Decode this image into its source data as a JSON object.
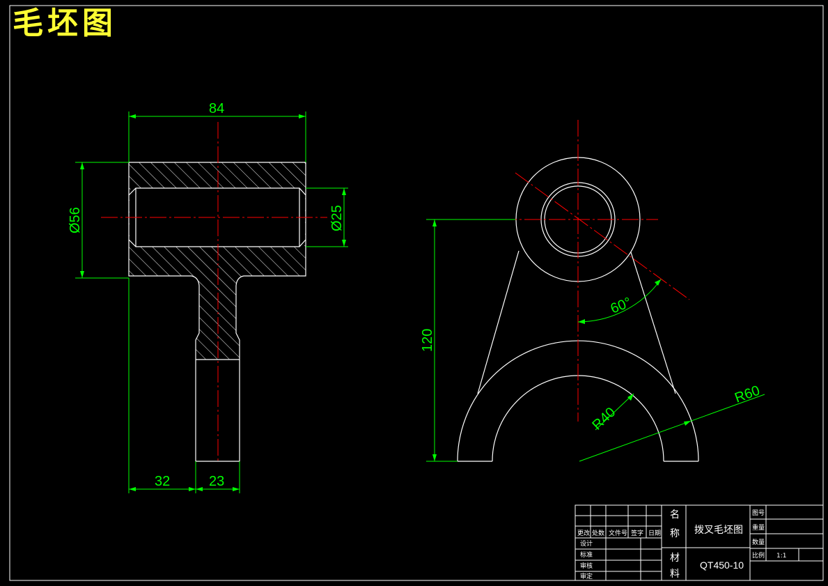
{
  "title": "毛坯图",
  "dimensions": {
    "width_top": "84",
    "dia_outer": "Ø56",
    "dia_bore": "Ø25",
    "len_a": "32",
    "len_b": "23",
    "height": "120",
    "angle": "60°",
    "r_inner": "R40",
    "r_outer": "R60"
  },
  "title_block": {
    "name_label_1": "名",
    "name_label_2": "称",
    "part_name": "拨叉毛坯图",
    "material_label_1": "材",
    "material_label_2": "料",
    "material": "QT450-10",
    "drawing_no_label": "图号",
    "weight_label": "重量",
    "quantity_label": "数量",
    "scale_label": "比例",
    "scale_value": "1:1",
    "rev_headers": [
      "更改",
      "处数",
      "文件号",
      "签字",
      "日期"
    ],
    "design_label": "设计",
    "standard_label": "标准",
    "review_label": "审核",
    "approve_label": "审定"
  },
  "colors": {
    "background": "#000000",
    "outline": "#ffffff",
    "dimension": "#00ff00",
    "centerline": "#ff0000",
    "title": "#ffff33"
  }
}
